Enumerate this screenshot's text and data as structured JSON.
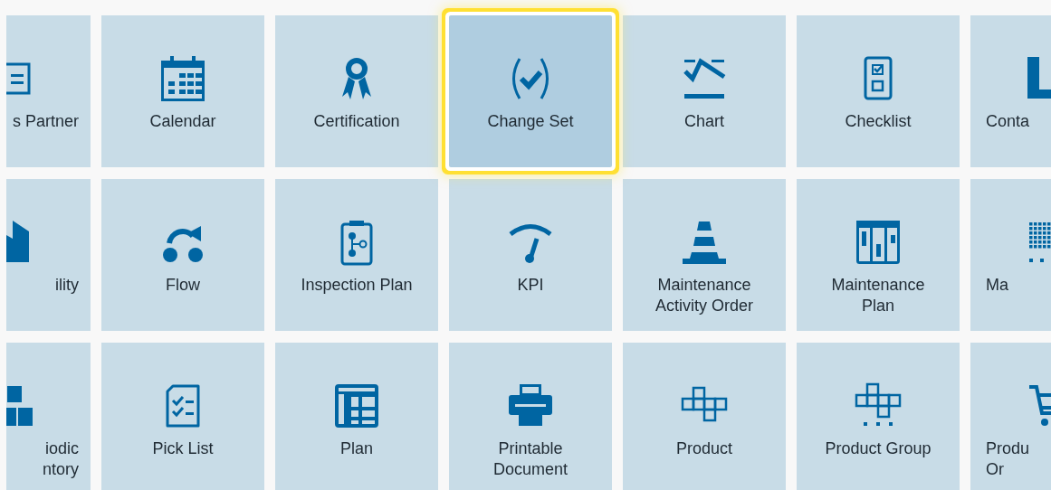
{
  "rows": [
    {
      "tiles": [
        {
          "label": "s Partner",
          "selected": false
        },
        {
          "label": "Calendar",
          "selected": false
        },
        {
          "label": "Certification",
          "selected": false
        },
        {
          "label": "Change Set",
          "selected": true
        },
        {
          "label": "Chart",
          "selected": false
        },
        {
          "label": "Checklist",
          "selected": false
        },
        {
          "label": "Conta",
          "selected": false
        }
      ]
    },
    {
      "tiles": [
        {
          "label": "ility",
          "selected": false
        },
        {
          "label": "Flow",
          "selected": false
        },
        {
          "label": "Inspection Plan",
          "selected": false
        },
        {
          "label": "KPI",
          "selected": false
        },
        {
          "label": "Maintenance\nActivity Order",
          "selected": false
        },
        {
          "label": "Maintenance\nPlan",
          "selected": false
        },
        {
          "label": "Ma",
          "selected": false
        }
      ]
    },
    {
      "tiles": [
        {
          "label": "iodic\nntory",
          "selected": false
        },
        {
          "label": "Pick List",
          "selected": false
        },
        {
          "label": "Plan",
          "selected": false
        },
        {
          "label": "Printable\nDocument",
          "selected": false
        },
        {
          "label": "Product",
          "selected": false
        },
        {
          "label": "Product Group",
          "selected": false
        },
        {
          "label": "Produ\nOr",
          "selected": false
        }
      ]
    }
  ]
}
